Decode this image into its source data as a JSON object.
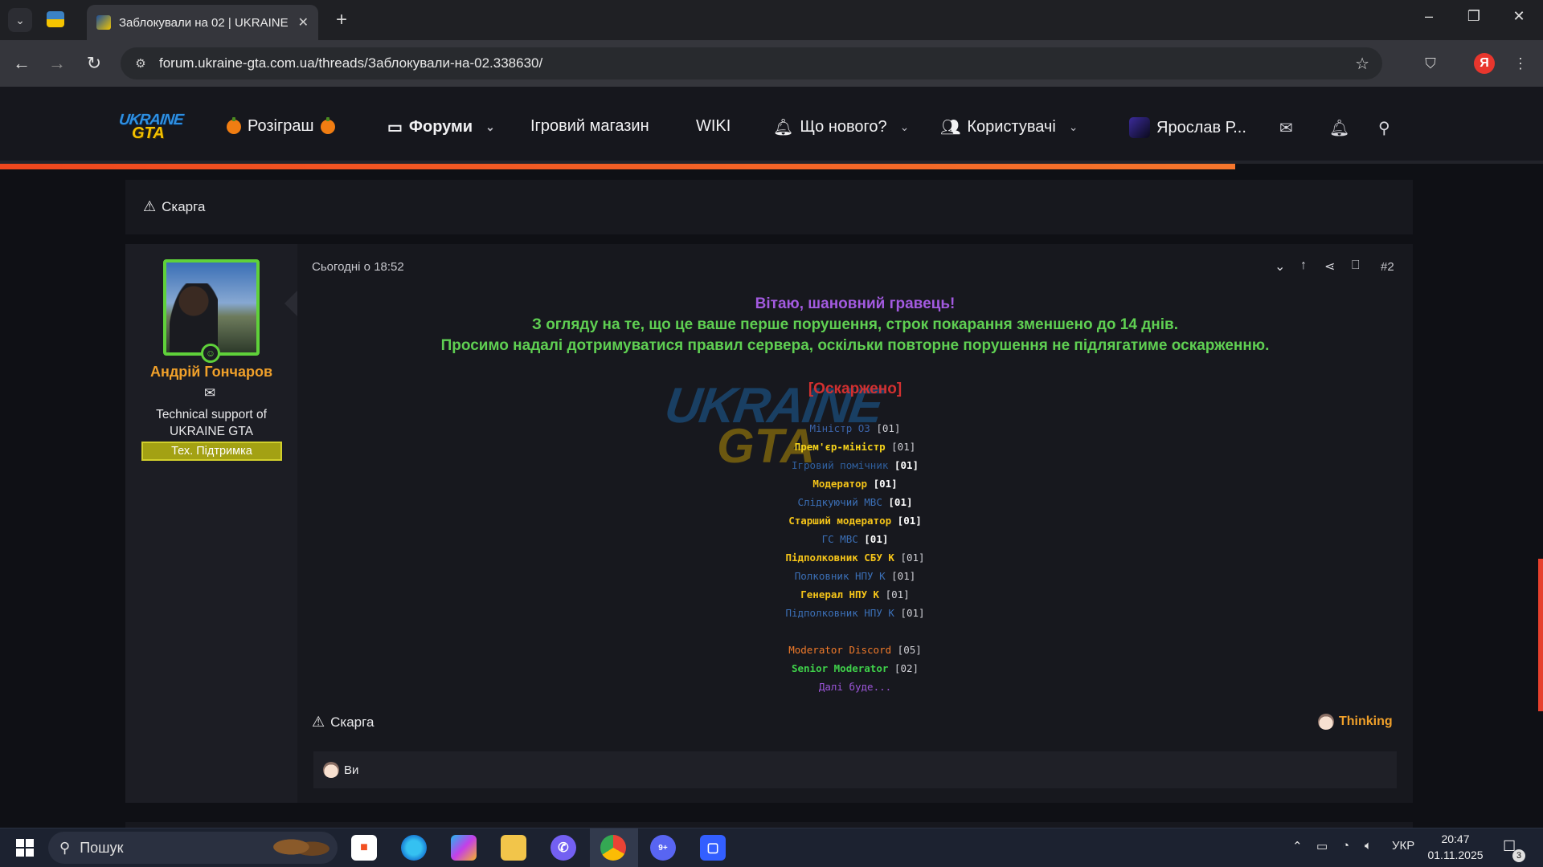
{
  "browser": {
    "tab_title": "Заблокували на 02 | UKRAINE GTA",
    "url": "forum.ukraine-gta.com.ua/threads/Заблокували-на-02.338630/",
    "profile_letter": "Я"
  },
  "nav": {
    "giveaway": "Розіграш",
    "forums": "Форуми",
    "shop": "Ігровий магазин",
    "wiki": "WIKI",
    "whats_new": "Що нового?",
    "users": "Користувачі",
    "account": "Ярослав Р..."
  },
  "logo": {
    "line1": "UKRAINE",
    "line2": "GTA"
  },
  "prev_post": {
    "report": "Скарга"
  },
  "post": {
    "date": "Сьогодні о 18:52",
    "number": "#2",
    "author": {
      "name": "Андрій Гончаров",
      "title": "Technical support of UKRAINE GTA",
      "badge": "Тех. Підтримка"
    },
    "greeting": "Вітаю, шановний гравець!",
    "line1": "З огляду на те, що це ваше перше порушення, строк покарання зменшено до 14 днів.",
    "line2": "Просимо надалі дотримуватися правил сервера, оскільки повторне порушення не підлягатиме оскарженню.",
    "status": "[Оскаржено]",
    "roles": [
      {
        "name": "Міністр ОЗ",
        "count": "[01]",
        "color": "#3b63a8",
        "bold_count": false,
        "bold_name": false
      },
      {
        "name": "Прем'єр-міністр",
        "count": "[01]",
        "color": "#f5d21a",
        "bold_count": false,
        "bold_name": true
      },
      {
        "name": "Ігровий помічник",
        "count": "[01]",
        "color": "#2f5f9e",
        "bold_count": true,
        "bold_name": false
      },
      {
        "name": "Модератор",
        "count": "[01]",
        "color": "#f5c419",
        "bold_count": true,
        "bold_name": true
      },
      {
        "name": "Слідкуючий МВС",
        "count": "[01]",
        "color": "#3b6fb6",
        "bold_count": true,
        "bold_name": false
      },
      {
        "name": "Старший модератор",
        "count": "[01]",
        "color": "#f5c419",
        "bold_count": true,
        "bold_name": true
      },
      {
        "name": "ГС МВС",
        "count": "[01]",
        "color": "#3b6fb6",
        "bold_count": true,
        "bold_name": false
      },
      {
        "name": "Підполковник СБУ К",
        "count": "[01]",
        "color": "#f5c419",
        "bold_count": false,
        "bold_name": true
      },
      {
        "name": "Полковник НПУ К",
        "count": "[01]",
        "color": "#3b6fb6",
        "bold_count": false,
        "bold_name": false
      },
      {
        "name": "Генерал НПУ К",
        "count": "[01]",
        "color": "#f5c419",
        "bold_count": false,
        "bold_name": true
      },
      {
        "name": "Підполковник НПУ К",
        "count": "[01]",
        "color": "#3b6fb6",
        "bold_count": false,
        "bold_name": false
      },
      {
        "name": "",
        "count": "",
        "color": "#ffffff",
        "bold_count": false,
        "bold_name": false
      },
      {
        "name": "Moderator Discord",
        "count": "[05]",
        "color": "#f07a2a",
        "bold_count": false,
        "bold_name": false
      },
      {
        "name": "Senior Moderator",
        "count": "[02]",
        "color": "#3fd14a",
        "bold_count": false,
        "bold_name": true
      },
      {
        "name": "Далі буде...",
        "count": "",
        "color": "#9b55d8",
        "bold_count": false,
        "bold_name": false
      }
    ],
    "report": "Скарга",
    "reaction": "Thinking",
    "reacted_by": "Ви"
  },
  "colors": {
    "greeting": "#a35ae0",
    "body_green": "#5fcf52",
    "status_red": "#d23030",
    "accent_orange": "#f0a02a"
  },
  "taskbar": {
    "search": "Пошук",
    "lang": "УКР",
    "time": "20:47",
    "date": "01.11.2025",
    "notifications": "3",
    "discord_badge": "9+"
  }
}
